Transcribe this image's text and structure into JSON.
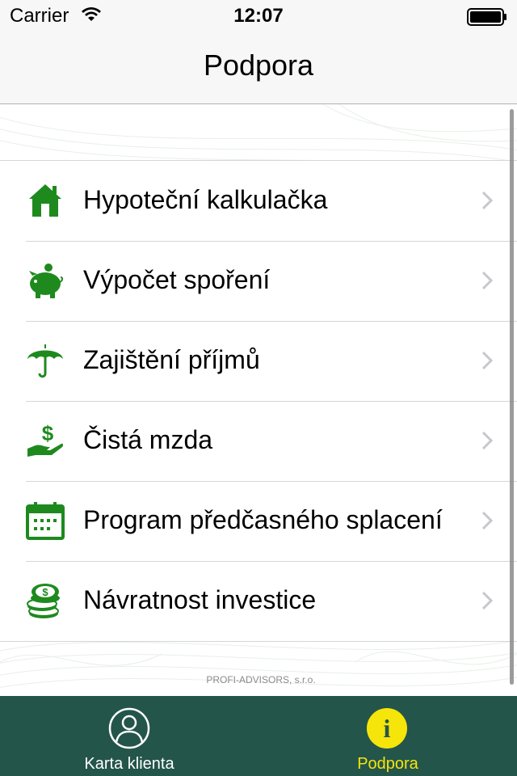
{
  "status_bar": {
    "carrier": "Carrier",
    "time": "12:07"
  },
  "nav": {
    "title": "Podpora"
  },
  "menu": {
    "items": [
      {
        "label": "Hypoteční kalkulačka",
        "icon": "house-icon"
      },
      {
        "label": "Výpočet spoření",
        "icon": "piggy-bank-icon"
      },
      {
        "label": "Zajištění příjmů",
        "icon": "umbrella-icon"
      },
      {
        "label": "Čistá mzda",
        "icon": "dollar-hand-icon"
      },
      {
        "label": "Program předčasného splacení",
        "icon": "calendar-icon"
      },
      {
        "label": "Návratnost investice",
        "icon": "coin-stack-icon"
      }
    ]
  },
  "footer": {
    "company": "PROFI-ADVISORS, s.r.o."
  },
  "tabbar": {
    "tabs": [
      {
        "label": "Karta klienta",
        "icon": "user-circle-icon",
        "selected": false
      },
      {
        "label": "Podpora",
        "icon": "info-icon",
        "selected": true
      }
    ]
  },
  "colors": {
    "icon_green": "#1e8a1e",
    "tabbar_bg": "#24554a",
    "tab_selected": "#f5e50b",
    "tab_unselected": "#ffffff"
  }
}
